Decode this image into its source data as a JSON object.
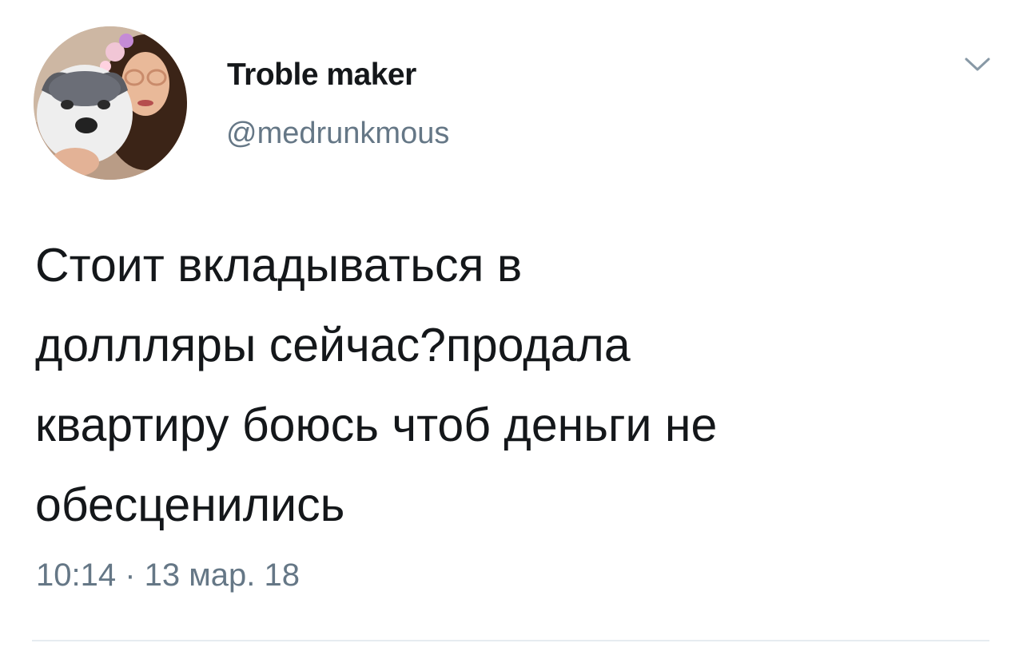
{
  "tweet": {
    "author": {
      "display_name": "Troble maker",
      "handle": "@medrunkmous",
      "avatar_icon": "profile-photo"
    },
    "menu_icon": "chevron-down-icon",
    "text": "Стоит вкладываться в\nдоллляры сейчас?продала\nквартиру боюсь чтоб деньги не\nобесценились",
    "timestamp": "10:14 · 13 мар. 18"
  },
  "colors": {
    "text_primary": "#14171a",
    "text_secondary": "#657786",
    "divider": "#e6ecf0",
    "background": "#ffffff"
  }
}
